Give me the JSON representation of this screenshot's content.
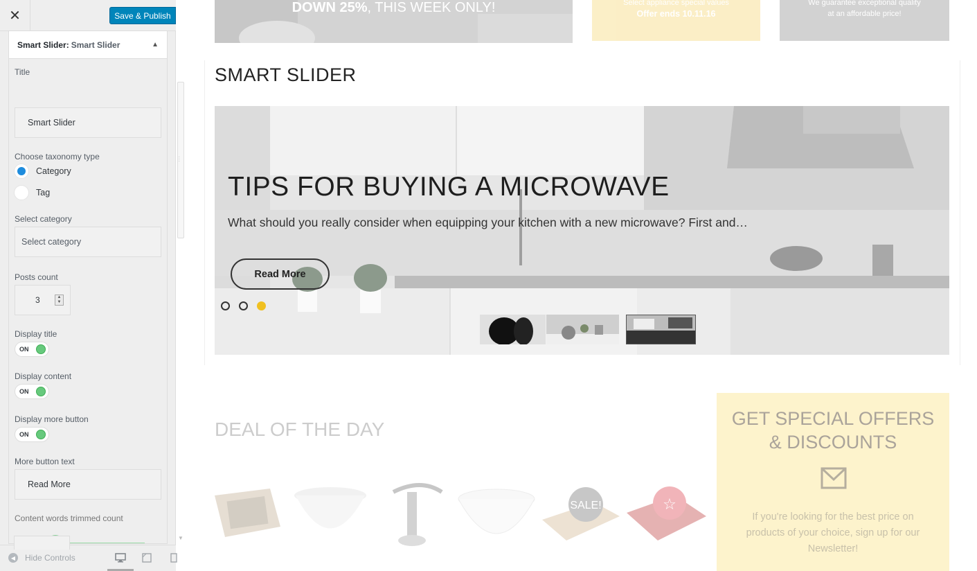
{
  "topbar": {
    "close_label": "✕",
    "publish_label": "Save & Publish"
  },
  "section": {
    "prefix": "Smart Slider:",
    "name": "Smart Slider"
  },
  "controls": {
    "title_label": "Title",
    "title_value": "Smart Slider",
    "taxonomy_label": "Choose taxonomy type",
    "taxonomy_options": [
      "Category",
      "Tag"
    ],
    "taxonomy_selected": "Category",
    "category_label": "Select category",
    "category_placeholder": "Select category",
    "posts_count_label": "Posts count",
    "posts_count_value": "3",
    "display_title_label": "Display title",
    "display_content_label": "Display content",
    "display_more_label": "Display more button",
    "toggle_on_text": "ON",
    "more_text_label": "More button text",
    "more_text_value": "Read More",
    "trim_label": "Content words trimmed count",
    "trim_fraction": 0.29
  },
  "footer": {
    "hide_controls_label": "Hide Controls",
    "devices": [
      "desktop",
      "tablet",
      "mobile"
    ],
    "active_device": "desktop"
  },
  "preview": {
    "banner1_main": "DOWN 25%",
    "banner1_rest": ", THIS WEEK ONLY!",
    "banner2_line1": "Select appliance special values",
    "banner2_line2": "Offer ends 10.11.16",
    "banner3_line1": "We guarantee exceptional quality",
    "banner3_line2": "at an affordable price!",
    "slider_title": "SMART SLIDER",
    "slide_headline": "TIPS FOR BUYING A MICROWAVE",
    "slide_excerpt": "What should you really consider when equipping your kitchen with a new microwave? First and…",
    "read_more_label": "Read More",
    "active_dot": 3,
    "deal_title": "DEAL OF THE DAY",
    "sale_badge": "SALE!",
    "offer_title_line1": "GET SPECIAL OFFERS",
    "offer_title_line2": "& DISCOUNTS",
    "offer_text": "If you're looking for the best price on products of your choice, sign up for our Newsletter!"
  },
  "colors": {
    "primary": "#0085ba",
    "toggle_on": "#67c97d",
    "radio_checked": "#1e8cdd",
    "active_dot": "#f0c020",
    "offer_bg": "#fdf3cc"
  }
}
